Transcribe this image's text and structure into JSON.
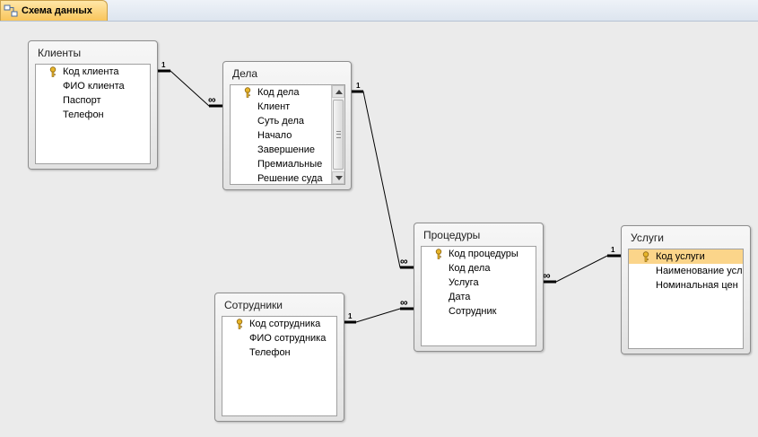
{
  "document_tab": {
    "title": "Схема данных",
    "icon": "relationships-icon"
  },
  "tables": {
    "clients": {
      "title": "Клиенты",
      "fields": [
        "Код клиента",
        "ФИО клиента",
        "Паспорт",
        "Телефон"
      ],
      "key_field_index": 0
    },
    "cases": {
      "title": "Дела",
      "fields": [
        "Код дела",
        "Клиент",
        "Суть дела",
        "Начало",
        "Завершение",
        "Премиальные",
        "Решение суда"
      ],
      "key_field_index": 0,
      "scrollbar": true
    },
    "procedures": {
      "title": "Процедуры",
      "fields": [
        "Код процедуры",
        "Код дела",
        "Услуга",
        "Дата",
        "Сотрудник"
      ],
      "key_field_index": 0
    },
    "employees": {
      "title": "Сотрудники",
      "fields": [
        "Код сотрудника",
        "ФИО сотрудника",
        "Телефон"
      ],
      "key_field_index": 0
    },
    "services": {
      "title": "Услуги",
      "fields": [
        "Код услуги",
        "Наименование усл",
        "Номинальная цен"
      ],
      "key_field_index": 0,
      "selected_field_index": 0
    }
  },
  "relationships": [
    {
      "from": "Клиенты",
      "to": "Дела",
      "one_label": "1",
      "many_label": "∞"
    },
    {
      "from": "Дела",
      "to": "Процедуры",
      "one_label": "1",
      "many_label": "∞"
    },
    {
      "from": "Сотрудники",
      "to": "Процедуры",
      "one_label": "1",
      "many_label": "∞"
    },
    {
      "from": "Услуги",
      "to": "Процедуры",
      "one_label": "1",
      "many_label": "∞"
    }
  ],
  "colors": {
    "selected_row": "#fbd58a",
    "tab": "#f9c55b",
    "key_icon": "#d6a21e"
  }
}
